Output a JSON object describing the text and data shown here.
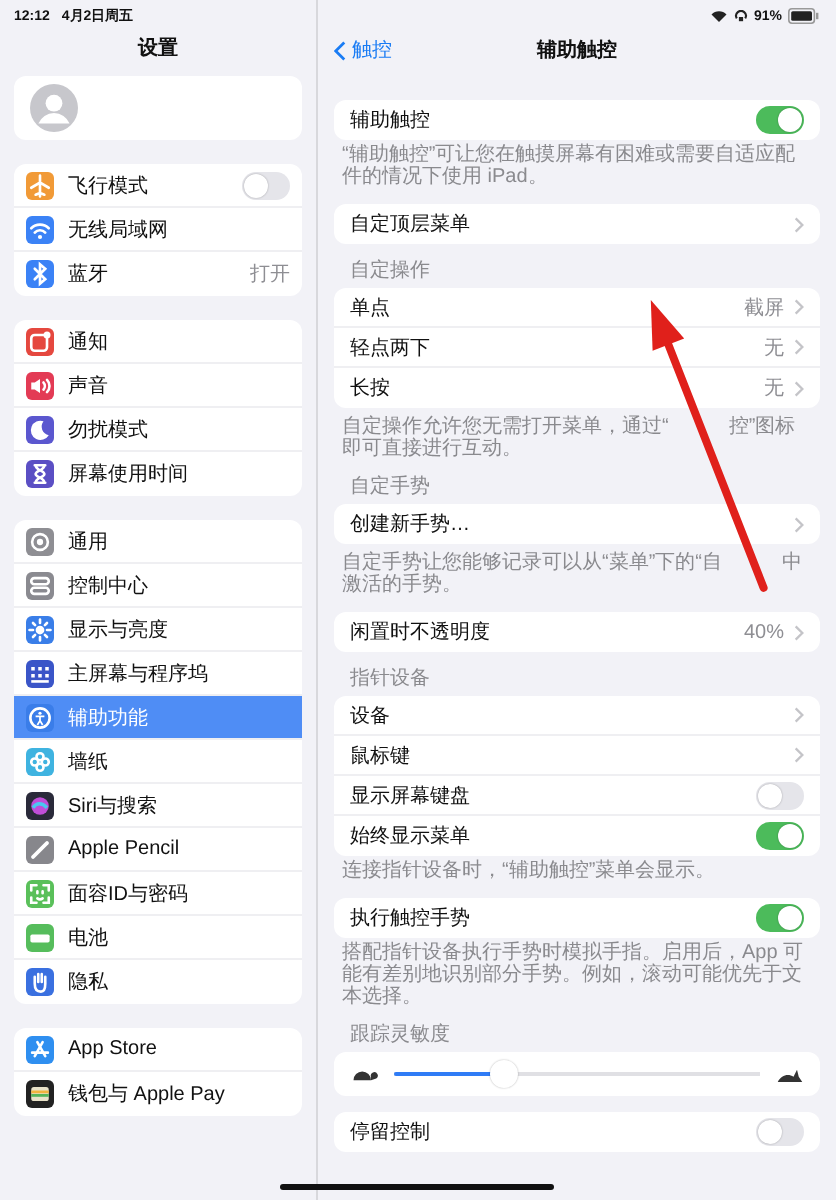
{
  "status_bar": {
    "time": "12:12",
    "date": "4月2日周五",
    "battery": "91%"
  },
  "sidebar": {
    "title": "设置",
    "groups": [
      [
        {
          "label": "飞行模式",
          "color": "#f19a37",
          "kind": "toggle",
          "on": false,
          "selected": false
        },
        {
          "label": "无线局域网",
          "color": "#3b82f6",
          "kind": "link",
          "selected": false
        },
        {
          "label": "蓝牙",
          "color": "#3b82f6",
          "kind": "link",
          "value": "打开",
          "selected": false
        }
      ],
      [
        {
          "label": "通知",
          "color": "#e5483f",
          "kind": "link",
          "selected": false
        },
        {
          "label": "声音",
          "color": "#e33b55",
          "kind": "link",
          "selected": false
        },
        {
          "label": "勿扰模式",
          "color": "#5b57cf",
          "kind": "link",
          "selected": false
        },
        {
          "label": "屏幕使用时间",
          "color": "#5b4fc4",
          "kind": "link",
          "selected": false
        }
      ],
      [
        {
          "label": "通用",
          "color": "#8e8e93",
          "kind": "link",
          "selected": false
        },
        {
          "label": "控制中心",
          "color": "#8a8a90",
          "kind": "link",
          "selected": false
        },
        {
          "label": "显示与亮度",
          "color": "#3a7ee8",
          "kind": "link",
          "selected": false
        },
        {
          "label": "主屏幕与程序坞",
          "color": "#3a55c8",
          "kind": "link",
          "selected": false
        },
        {
          "label": "辅助功能",
          "color": "#3a7de9",
          "kind": "link",
          "selected": true
        },
        {
          "label": "墙纸",
          "color": "#3fb3e0",
          "kind": "link",
          "selected": false
        },
        {
          "label": "Siri与搜索",
          "color": "#2a2a3a",
          "kind": "link",
          "selected": false
        },
        {
          "label": "Apple Pencil",
          "color": "#87878c",
          "kind": "link",
          "selected": false
        },
        {
          "label": "面容ID与密码",
          "color": "#5ac05a",
          "kind": "link",
          "selected": false
        },
        {
          "label": "电池",
          "color": "#56bd5c",
          "kind": "link",
          "selected": false
        },
        {
          "label": "隐私",
          "color": "#3a70e0",
          "kind": "link",
          "selected": false
        }
      ],
      [
        {
          "label": "App Store",
          "color": "#2f8ff0",
          "kind": "link",
          "selected": false
        },
        {
          "label": "钱包与 Apple Pay",
          "color": "#222222",
          "kind": "link",
          "selected": false
        }
      ]
    ]
  },
  "detail": {
    "back": "触控",
    "title": "辅助触控",
    "sections": [
      {
        "rows": [
          {
            "kind": "toggle",
            "label": "辅助触控",
            "on": true
          }
        ],
        "footer": "“辅助触控”可让您在触摸屏幕有困难或需要自适应配件的情况下使用 iPad。"
      },
      {
        "rows": [
          {
            "kind": "link",
            "label": "自定顶层菜单"
          }
        ]
      },
      {
        "header": "自定操作",
        "rows": [
          {
            "kind": "link",
            "label": "单点",
            "value": "截屏"
          },
          {
            "kind": "link",
            "label": "轻点两下",
            "value": "无"
          },
          {
            "kind": "link",
            "label": "长按",
            "value": "无"
          }
        ],
        "footer_parts": [
          "自定操作允许您无需打开菜单，通过“",
          "控”图标即可直接进行互动。"
        ]
      },
      {
        "header": "自定手势",
        "rows": [
          {
            "kind": "link",
            "label": "创建新手势…"
          }
        ],
        "footer_parts": [
          "自定手势让您能够记录可以从“菜单”下的“自",
          "中激活的手势。"
        ]
      },
      {
        "rows": [
          {
            "kind": "link",
            "label": "闲置时不透明度",
            "value": "40%"
          }
        ]
      },
      {
        "header": "指针设备",
        "rows": [
          {
            "kind": "link",
            "label": "设备"
          },
          {
            "kind": "link",
            "label": "鼠标键"
          },
          {
            "kind": "toggle",
            "label": "显示屏幕键盘",
            "on": false
          },
          {
            "kind": "toggle",
            "label": "始终显示菜单",
            "on": true
          }
        ],
        "footer": "连接指针设备时，“辅助触控”菜单会显示。"
      },
      {
        "rows": [
          {
            "kind": "toggle",
            "label": "执行触控手势",
            "on": true
          }
        ],
        "footer": "搭配指针设备执行手势时模拟手指。启用后，App 可能有差别地识别部分手势。例如，滚动可能优先于文本选择。"
      },
      {
        "header": "跟踪灵敏度",
        "rows": [
          {
            "kind": "slider",
            "level": 0.3
          }
        ]
      },
      {
        "rows": [
          {
            "kind": "toggle",
            "label": "停留控制",
            "on": false
          }
        ]
      }
    ]
  }
}
